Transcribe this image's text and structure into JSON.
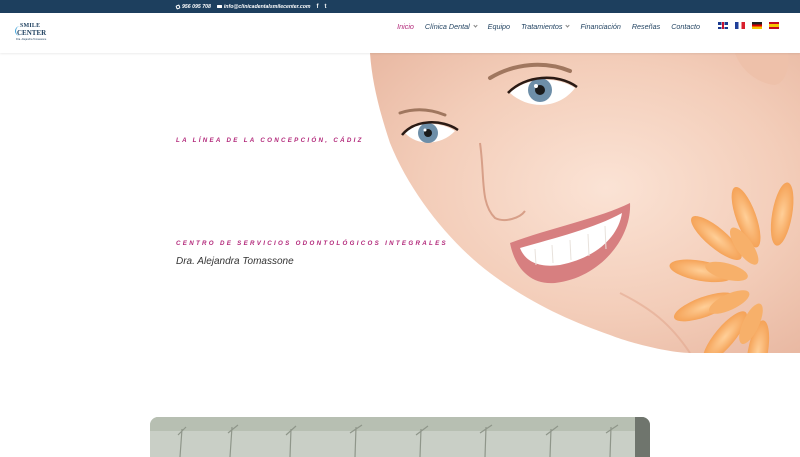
{
  "topbar": {
    "phone": "956 095 708",
    "email": "info@clinicadentalsmilecenter.com",
    "social": [
      {
        "icon": "facebook-icon",
        "label": "f"
      },
      {
        "icon": "twitter-icon",
        "label": "t"
      }
    ]
  },
  "logo": {
    "line1": "SMILE",
    "line2": "CENTER",
    "line3": "Dra. Alejandra Tomassone"
  },
  "nav": {
    "items": [
      {
        "label": "Inicio",
        "active": true,
        "dropdown": false
      },
      {
        "label": "Clínica Dental",
        "active": false,
        "dropdown": true
      },
      {
        "label": "Equipo",
        "active": false,
        "dropdown": false
      },
      {
        "label": "Tratamientos",
        "active": false,
        "dropdown": true
      },
      {
        "label": "Financiación",
        "active": false,
        "dropdown": false
      },
      {
        "label": "Reseñas",
        "active": false,
        "dropdown": false
      },
      {
        "label": "Contacto",
        "active": false,
        "dropdown": false
      }
    ],
    "flags": [
      "uk-flag-icon",
      "france-flag-icon",
      "germany-flag-icon",
      "spain-flag-icon"
    ]
  },
  "hero": {
    "tagline_location": "LA LÍNEA DE LA CONCEPCIÓN, CÁDIZ",
    "tagline_services": "CENTRO DE SERVICIOS ODONTOLÓGICOS INTEGRALES",
    "doctor": "Dra. Alejandra Tomassone"
  },
  "colors": {
    "topbar_bg": "#1d3f5e",
    "accent": "#b2287a",
    "nav_text": "#1d3f5e"
  }
}
